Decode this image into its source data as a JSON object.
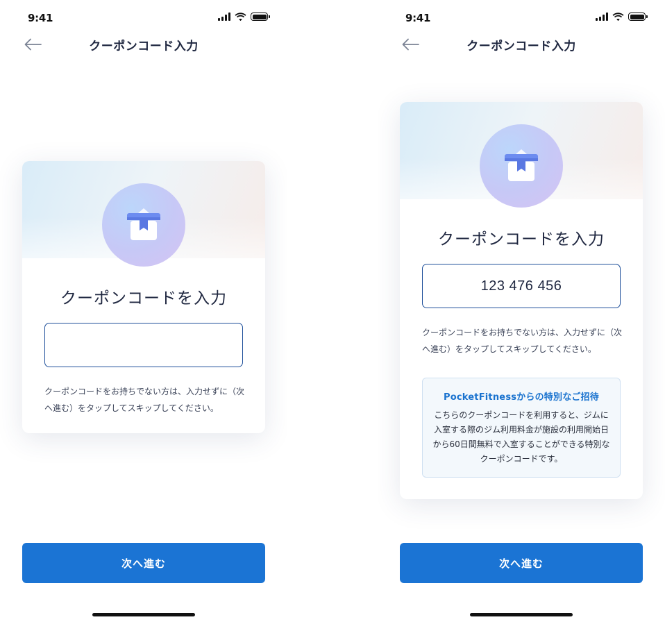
{
  "status_bar": {
    "time": "9:41"
  },
  "nav": {
    "title": "クーポンコード入力"
  },
  "card": {
    "title": "クーポンコードを入力",
    "hint": "クーポンコードをお持ちでない方は、入力せずに（次へ進む）をタップしてスキップしてください。"
  },
  "screens": {
    "left": {
      "input_value": ""
    },
    "right": {
      "input_value": "123 476 456",
      "invite": {
        "title": "PocketFitnessからの特別なご招待",
        "body": "こちらのクーポンコードを利用すると、ジムに入室する際のジム利用料金が施設の利用開始日から60日間無料で入室することができる特別なクーポンコードです。"
      }
    }
  },
  "next_button_label": "次へ進む",
  "colors": {
    "accent": "#1b74d4",
    "input_border": "#1e4f9a",
    "invite_title": "#1a73cf",
    "title_text": "#1f2740"
  },
  "icons": {
    "back": "arrow-left-icon",
    "gift": "gift-icon",
    "signal": "signal-icon",
    "wifi": "wifi-icon",
    "battery": "battery-icon"
  }
}
